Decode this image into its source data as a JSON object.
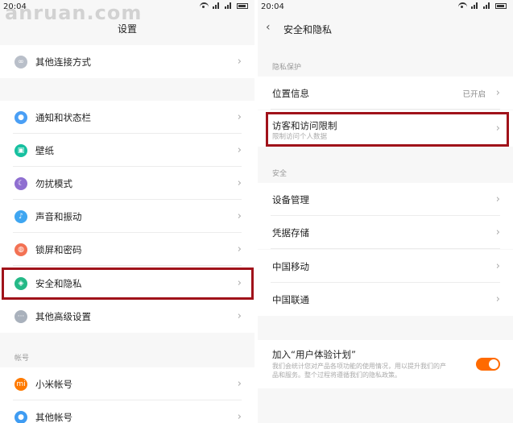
{
  "left": {
    "status_time": "20:04",
    "watermark": "anruan.com",
    "title": "设置",
    "groups": {
      "top": [
        {
          "label": "其他连接方式",
          "icon": "link-icon",
          "color": "#b9bfc9"
        }
      ],
      "main": [
        {
          "label": "通知和状态栏",
          "icon": "toggle-icon",
          "color": "#4a9ff5"
        },
        {
          "label": "壁纸",
          "icon": "wallpaper-icon",
          "color": "#17c0a0"
        },
        {
          "label": "勿扰模式",
          "icon": "moon-icon",
          "color": "#8f6fd1"
        },
        {
          "label": "声音和振动",
          "icon": "speaker-icon",
          "color": "#3fa6f1"
        },
        {
          "label": "锁屏和密码",
          "icon": "lock-icon",
          "color": "#f37254"
        },
        {
          "label": "安全和隐私",
          "icon": "shield-icon",
          "color": "#25b987"
        },
        {
          "label": "其他高级设置",
          "icon": "more-icon",
          "color": "#a9b1bc"
        }
      ],
      "account_label": "帐号",
      "account": [
        {
          "label": "小米帐号",
          "icon": "mi-icon",
          "color": "#ff7a00"
        },
        {
          "label": "其他帐号",
          "icon": "person-icon",
          "color": "#3f9cf2"
        }
      ]
    }
  },
  "right": {
    "status_time": "20:04",
    "title": "安全和隐私",
    "section_privacy": "隐私保护",
    "location": {
      "label": "位置信息",
      "value": "已开启"
    },
    "visitor": {
      "label": "访客和访问限制",
      "sub": "限制访问个人数据"
    },
    "section_security": "安全",
    "items": [
      {
        "label": "设备管理"
      },
      {
        "label": "凭据存储"
      },
      {
        "label": "中国移动"
      },
      {
        "label": "中国联通"
      }
    ],
    "experience": {
      "label": "加入“用户体验计划”",
      "desc1": "我们会统计您对产品各项功能的使用情况，用以提升我们的产",
      "desc2": "品和服务。整个过程将遵循我们的隐私政策。"
    }
  },
  "colors": {
    "highlight": "#a0121a",
    "toggle_on": "#ff6a00"
  }
}
